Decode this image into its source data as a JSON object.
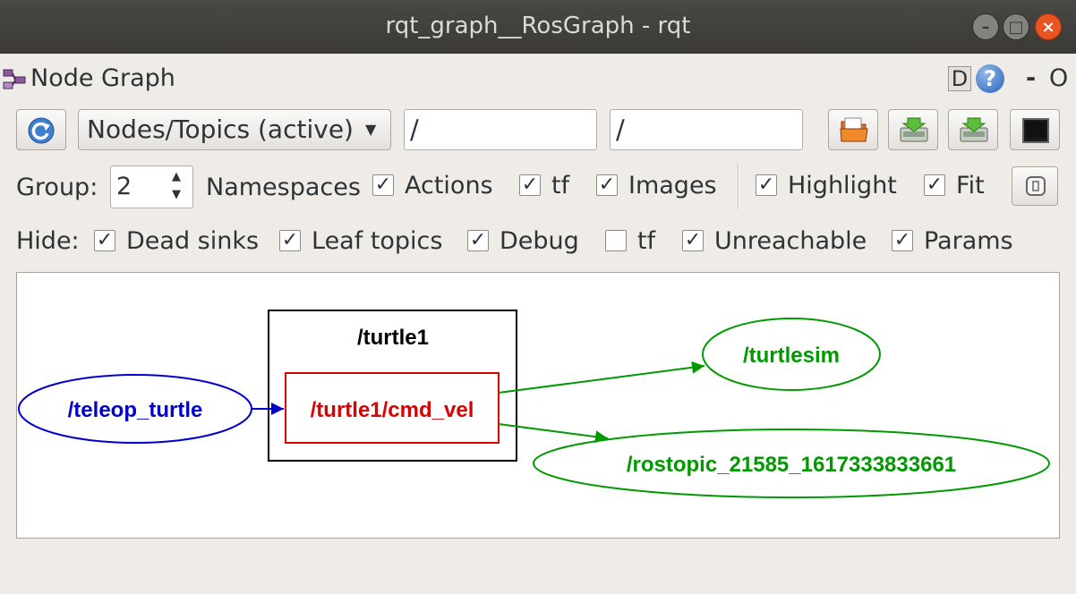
{
  "window": {
    "title": "rqt_graph__RosGraph - rqt",
    "minimize": "–",
    "maximize": "□",
    "close": "×"
  },
  "plugin": {
    "title": "Node Graph",
    "d_label": "D",
    "help_label": "?",
    "dash_label": "-",
    "o_label": "O"
  },
  "toolbar": {
    "refresh_icon": "refresh-icon",
    "mode_value": "Nodes/Topics (active)",
    "node_filter_value": "/",
    "topic_filter_value": "/",
    "load_icon": "folder-open-icon",
    "save_dot_icon": "save-dot-icon",
    "save_svg_icon": "save-svg-icon",
    "screenshot_icon": "screenshot-icon"
  },
  "group_row": {
    "group_label": "Group:",
    "group_value": "2",
    "namespaces_label": "Namespaces",
    "options": [
      {
        "label": "Actions",
        "checked": true
      },
      {
        "label": "tf",
        "checked": true
      },
      {
        "label": "Images",
        "checked": true
      },
      {
        "label": "Highlight",
        "checked": true
      },
      {
        "label": "Fit",
        "checked": true
      }
    ],
    "fit_button_icon": "fit-view-icon"
  },
  "hide_row": {
    "hide_label": "Hide:",
    "options": [
      {
        "label": "Dead sinks",
        "checked": true
      },
      {
        "label": "Leaf topics",
        "checked": true
      },
      {
        "label": "Debug",
        "checked": true
      },
      {
        "label": "tf",
        "checked": false
      },
      {
        "label": "Unreachable",
        "checked": true
      },
      {
        "label": "Params",
        "checked": true
      }
    ]
  },
  "graph": {
    "namespace_label": "/turtle1",
    "topic_label": "/turtle1/cmd_vel",
    "publisher_label": "/teleop_turtle",
    "subscriber1_label": "/turtlesim",
    "subscriber2_label": "/rostopic_21585_1617333833661",
    "colors": {
      "publisher": "#0000cc",
      "topic": "#dd0000",
      "subscriber": "#009900"
    }
  }
}
